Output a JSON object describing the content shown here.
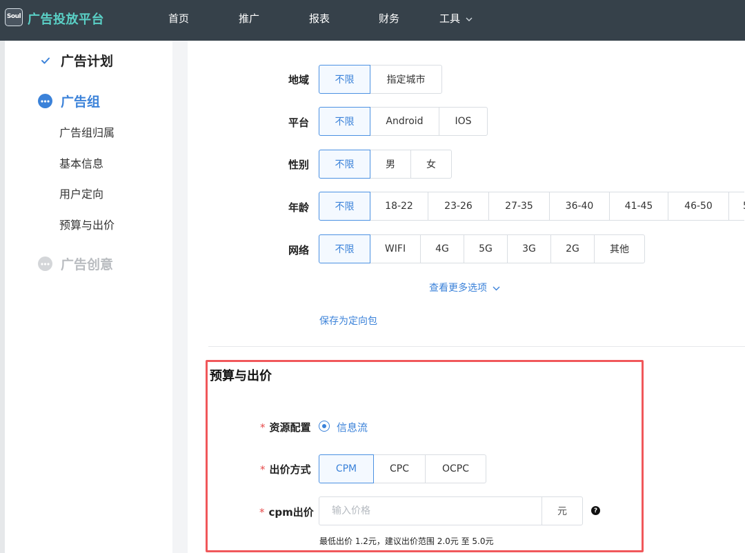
{
  "header": {
    "logo_text": "Soul",
    "brand": "广告投放平台",
    "nav": [
      "首页",
      "推广",
      "报表",
      "财务",
      "工具"
    ]
  },
  "sidebar": {
    "steps": [
      {
        "label": "广告计划",
        "state": "done"
      },
      {
        "label": "广告组",
        "state": "active"
      },
      {
        "label": "广告创意",
        "state": "pending"
      }
    ],
    "sub_items": [
      "广告组归属",
      "基本信息",
      "用户定向",
      "预算与出价"
    ]
  },
  "targeting": {
    "region": {
      "label": "地域",
      "options": [
        "不限",
        "指定城市"
      ],
      "selected": "不限"
    },
    "platform": {
      "label": "平台",
      "options": [
        "不限",
        "Android",
        "IOS"
      ],
      "selected": "不限"
    },
    "gender": {
      "label": "性别",
      "options": [
        "不限",
        "男",
        "女"
      ],
      "selected": "不限"
    },
    "age": {
      "label": "年龄",
      "options": [
        "不限",
        "18-22",
        "23-26",
        "27-35",
        "36-40",
        "41-45",
        "46-50",
        "5"
      ],
      "selected": "不限"
    },
    "network": {
      "label": "网络",
      "options": [
        "不限",
        "WIFI",
        "4G",
        "5G",
        "3G",
        "2G",
        "其他"
      ],
      "selected": "不限"
    },
    "more_options": "查看更多选项",
    "save_package": "保存为定向包"
  },
  "budget": {
    "title": "预算与出价",
    "required_mark": "*",
    "resource": {
      "label": "资源配置",
      "value": "信息流"
    },
    "bid_method": {
      "label": "出价方式",
      "options": [
        "CPM",
        "CPC",
        "OCPC"
      ],
      "selected": "CPM"
    },
    "cpm_bid": {
      "label": "cpm出价",
      "placeholder": "输入价格",
      "unit": "元"
    },
    "hint": "最低出价 1.2元，建议出价范围 2.0元 至 5.0元"
  },
  "colors": {
    "primary": "#3b82d9",
    "header_bg": "#36414a",
    "brand": "#5ad0c6",
    "highlight_border": "#f0575a"
  },
  "icons": {
    "done": "check-icon",
    "active": "more-dots-icon",
    "pending": "more-dots-icon",
    "dropdown": "chevron-down-icon",
    "help": "question-icon"
  }
}
